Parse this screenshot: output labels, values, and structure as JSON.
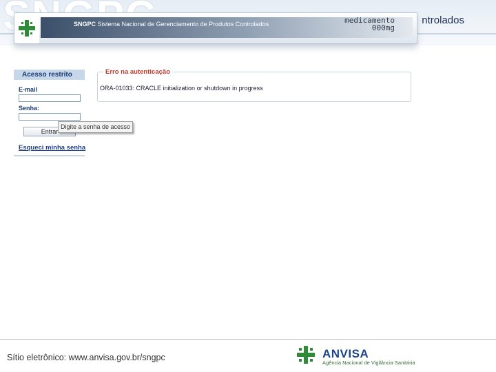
{
  "slide": {
    "big_title": "SNGPC",
    "sub_title": "ntrolados"
  },
  "banner": {
    "acronym": "SNGPC",
    "system_name": "Sistema Nacional de Gerenciamento de Produtos Controlados",
    "med_line1": "medicamento",
    "med_line2": "000mg"
  },
  "login": {
    "header": "Acesso restrito",
    "email_label": "E-mail",
    "email_value": "",
    "password_label": "Senha:",
    "password_value": "",
    "enter_label": "Entrar",
    "forgot_label": "Esqueci minha senha",
    "tooltip": "Digite a senha de acesso"
  },
  "error": {
    "title": "Erro na autenticação",
    "message": "ORA-01033: CRACLE initialization or shutdown in progress"
  },
  "footer": {
    "site": "Sítio eletrônico: www.anvisa.gov.br/sngpc",
    "anvisa_name": "ANVISA",
    "anvisa_subtitle": "Agência Nacional de Vigilância Sanitária"
  },
  "colors": {
    "brand_green": "#2f8a3a",
    "brand_blue": "#1c4587",
    "error_red": "#c0392b"
  }
}
